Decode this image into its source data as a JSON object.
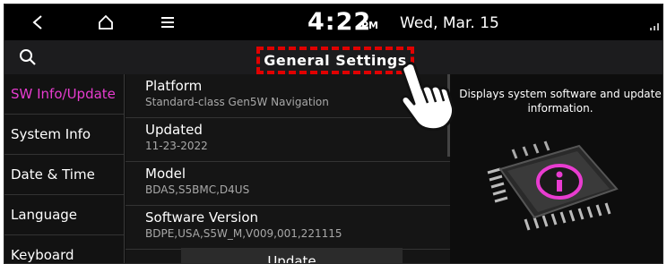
{
  "status_bar": {
    "time": "4:22",
    "ampm": "PM",
    "date": "Wed, Mar. 15"
  },
  "header": {
    "title": "General Settings"
  },
  "sidebar": {
    "items": [
      {
        "label": "SW Info/Update",
        "active": true
      },
      {
        "label": "System Info",
        "active": false
      },
      {
        "label": "Date & Time",
        "active": false
      },
      {
        "label": "Language",
        "active": false
      },
      {
        "label": "Keyboard",
        "active": false
      }
    ]
  },
  "info": {
    "rows": [
      {
        "title": "Platform",
        "value": "Standard-class Gen5W Navigation"
      },
      {
        "title": "Updated",
        "value": "11-23-2022"
      },
      {
        "title": "Model",
        "value": "BDAS,S5BMC,D4US"
      },
      {
        "title": "Software Version",
        "value": "BDPE,USA,S5W_M,V009,001,221115"
      }
    ],
    "update_label": "Update"
  },
  "panel": {
    "description": "Displays system software and update information."
  },
  "colors": {
    "accent": "#e83cd0",
    "highlight_box": "#e10000"
  },
  "icons": [
    "back-icon",
    "home-icon",
    "menu-icon",
    "signal-icon",
    "search-icon",
    "info-chip-icon",
    "hand-pointer-icon"
  ]
}
